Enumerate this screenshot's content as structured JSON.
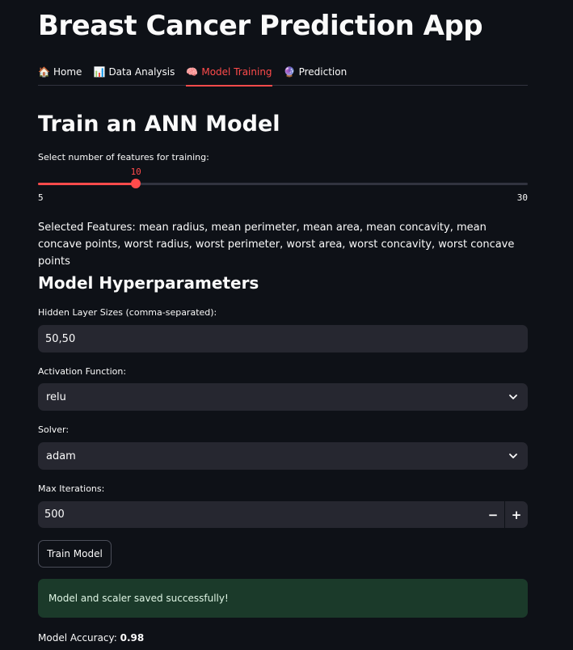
{
  "app": {
    "title": "Breast Cancer Prediction App"
  },
  "tabs": [
    {
      "icon": "house-icon",
      "glyph": "🏠",
      "label": "Home",
      "active": false
    },
    {
      "icon": "bar-chart-icon",
      "glyph": "📊",
      "label": "Data Analysis",
      "active": false
    },
    {
      "icon": "brain-icon",
      "glyph": "🧠",
      "label": "Model Training",
      "active": true
    },
    {
      "icon": "crystal-ball-icon",
      "glyph": "🔮",
      "label": "Prediction",
      "active": false
    }
  ],
  "training": {
    "title": "Train an ANN Model",
    "slider": {
      "label": "Select number of features for training:",
      "value": "10",
      "min": "5",
      "max": "30"
    },
    "selected_features_text": "Selected Features: mean radius, mean perimeter, mean area, mean concavity, mean concave points, worst radius, worst perimeter, worst area, worst concavity, worst concave points"
  },
  "hyperparameters": {
    "title": "Model Hyperparameters",
    "hidden_layers": {
      "label": "Hidden Layer Sizes (comma-separated):",
      "value": "50,50"
    },
    "activation": {
      "label": "Activation Function:",
      "value": "relu"
    },
    "solver": {
      "label": "Solver:",
      "value": "adam"
    },
    "max_iter": {
      "label": "Max Iterations:",
      "value": "500",
      "minus": "−",
      "plus": "+"
    }
  },
  "actions": {
    "train_label": "Train Model"
  },
  "result": {
    "success_message": "Model and scaler saved successfully!",
    "accuracy_label": "Model Accuracy:",
    "accuracy_value": "0.98"
  },
  "colors": {
    "background": "#0e1117",
    "accent": "#ff4b4b",
    "input_bg": "#262730",
    "success_bg": "#1b3a2a"
  }
}
